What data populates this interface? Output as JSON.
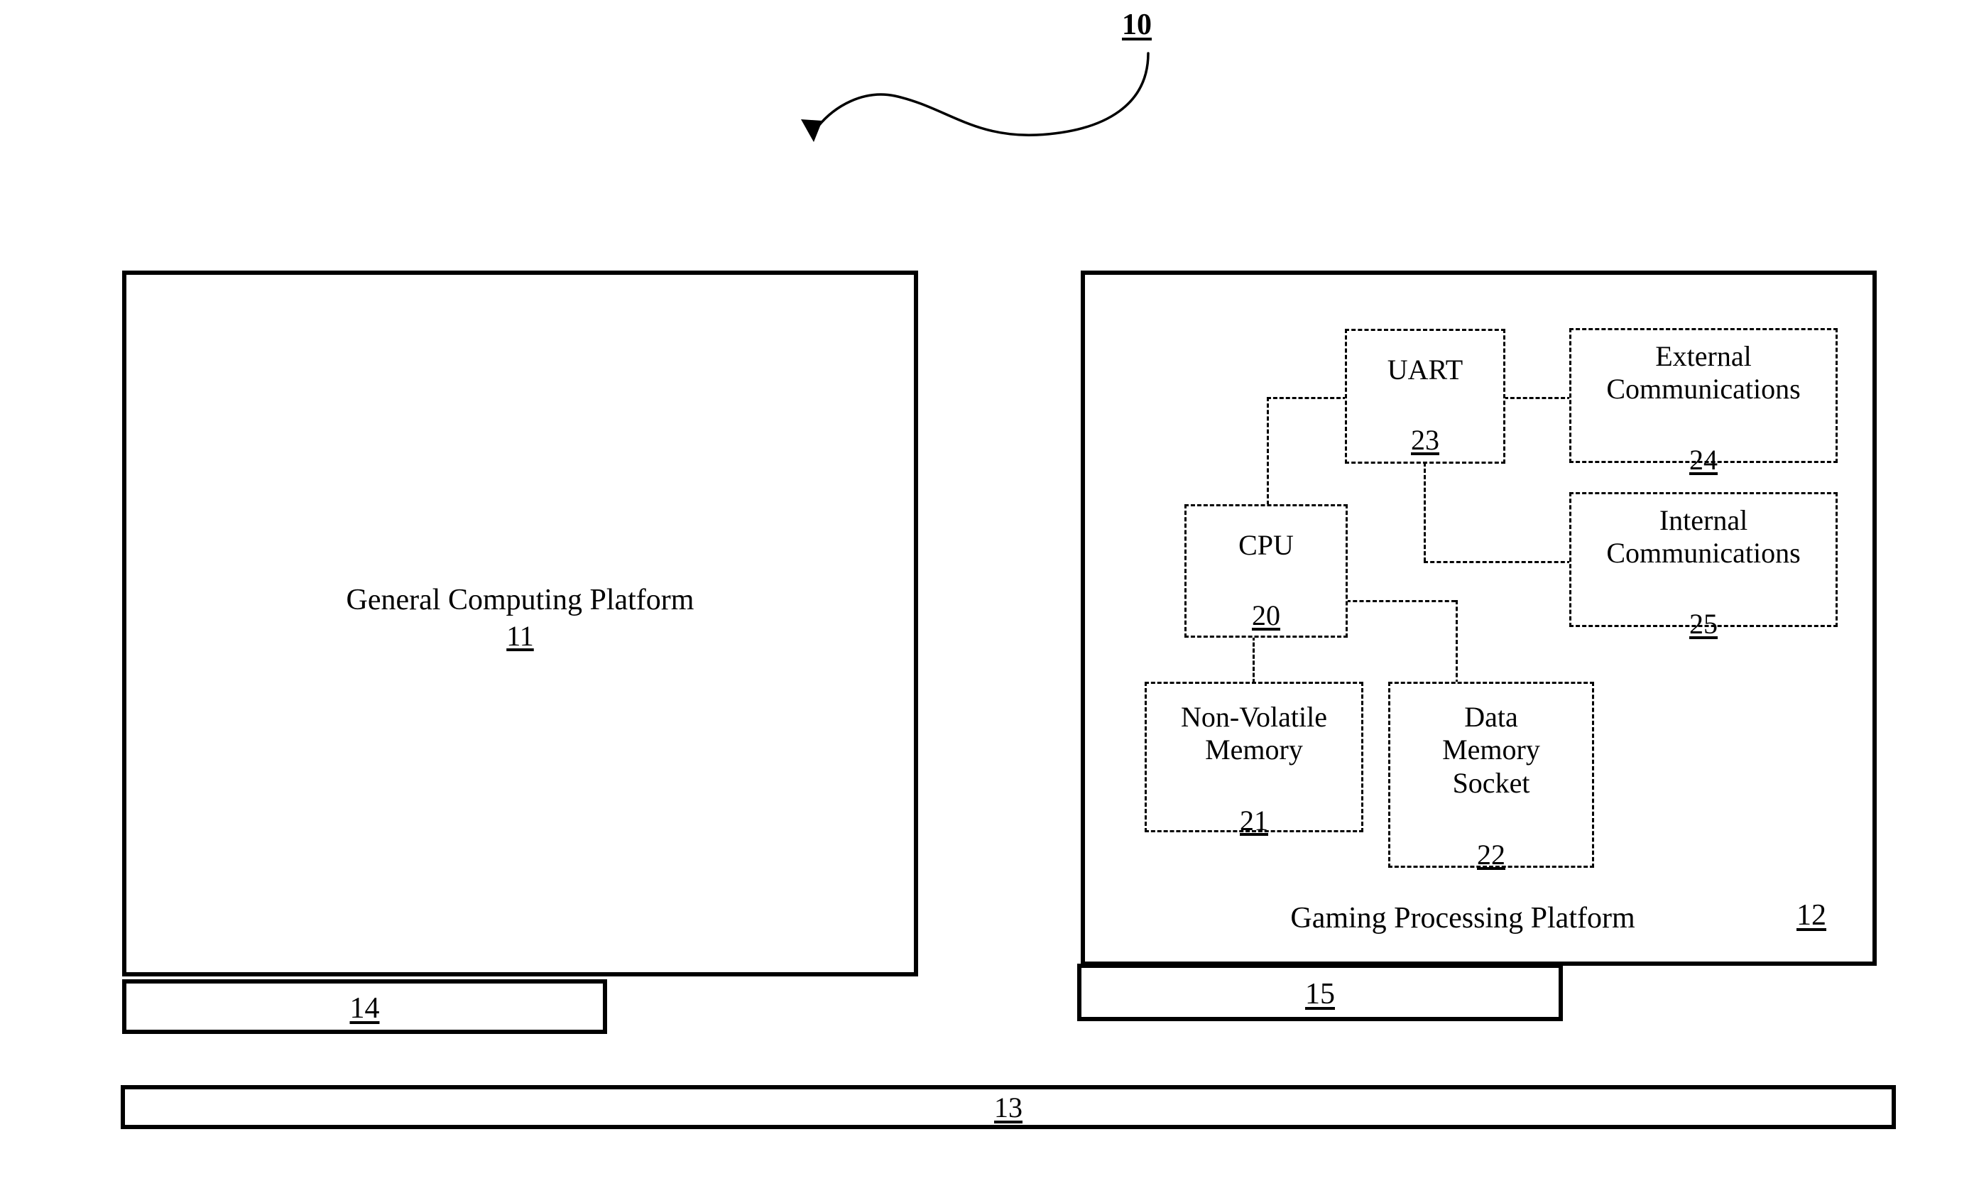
{
  "figure": {
    "figure_ref": "10"
  },
  "platforms": {
    "general": {
      "title": "General Computing Platform",
      "ref": "11",
      "port_ref": "14"
    },
    "gaming": {
      "title": "Gaming Processing Platform",
      "ref": "12",
      "port_ref": "15"
    },
    "bus": {
      "ref": "13"
    }
  },
  "components": [
    {
      "name": "uart",
      "label": "UART",
      "ref": "23"
    },
    {
      "name": "external-communications",
      "label": "External\nCommunications",
      "ref": "24"
    },
    {
      "name": "internal-communications",
      "label": "Internal\nCommunications",
      "ref": "25"
    },
    {
      "name": "cpu",
      "label": "CPU",
      "ref": "20"
    },
    {
      "name": "non-volatile-memory",
      "label": "Non-Volatile\nMemory",
      "ref": "21"
    },
    {
      "name": "data-memory-socket",
      "label": "Data\nMemory\nSocket",
      "ref": "22"
    }
  ]
}
